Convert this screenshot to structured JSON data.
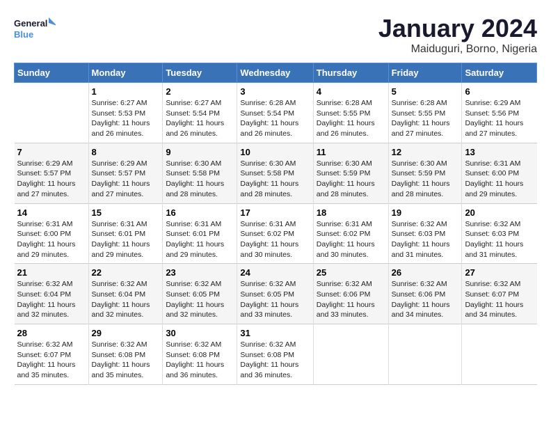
{
  "header": {
    "logo_line1": "General",
    "logo_line2": "Blue",
    "month": "January 2024",
    "location": "Maiduguri, Borno, Nigeria"
  },
  "days_of_week": [
    "Sunday",
    "Monday",
    "Tuesday",
    "Wednesday",
    "Thursday",
    "Friday",
    "Saturday"
  ],
  "weeks": [
    [
      {
        "num": "",
        "info": ""
      },
      {
        "num": "1",
        "info": "Sunrise: 6:27 AM\nSunset: 5:53 PM\nDaylight: 11 hours\nand 26 minutes."
      },
      {
        "num": "2",
        "info": "Sunrise: 6:27 AM\nSunset: 5:54 PM\nDaylight: 11 hours\nand 26 minutes."
      },
      {
        "num": "3",
        "info": "Sunrise: 6:28 AM\nSunset: 5:54 PM\nDaylight: 11 hours\nand 26 minutes."
      },
      {
        "num": "4",
        "info": "Sunrise: 6:28 AM\nSunset: 5:55 PM\nDaylight: 11 hours\nand 26 minutes."
      },
      {
        "num": "5",
        "info": "Sunrise: 6:28 AM\nSunset: 5:55 PM\nDaylight: 11 hours\nand 27 minutes."
      },
      {
        "num": "6",
        "info": "Sunrise: 6:29 AM\nSunset: 5:56 PM\nDaylight: 11 hours\nand 27 minutes."
      }
    ],
    [
      {
        "num": "7",
        "info": "Sunrise: 6:29 AM\nSunset: 5:57 PM\nDaylight: 11 hours\nand 27 minutes."
      },
      {
        "num": "8",
        "info": "Sunrise: 6:29 AM\nSunset: 5:57 PM\nDaylight: 11 hours\nand 27 minutes."
      },
      {
        "num": "9",
        "info": "Sunrise: 6:30 AM\nSunset: 5:58 PM\nDaylight: 11 hours\nand 28 minutes."
      },
      {
        "num": "10",
        "info": "Sunrise: 6:30 AM\nSunset: 5:58 PM\nDaylight: 11 hours\nand 28 minutes."
      },
      {
        "num": "11",
        "info": "Sunrise: 6:30 AM\nSunset: 5:59 PM\nDaylight: 11 hours\nand 28 minutes."
      },
      {
        "num": "12",
        "info": "Sunrise: 6:30 AM\nSunset: 5:59 PM\nDaylight: 11 hours\nand 28 minutes."
      },
      {
        "num": "13",
        "info": "Sunrise: 6:31 AM\nSunset: 6:00 PM\nDaylight: 11 hours\nand 29 minutes."
      }
    ],
    [
      {
        "num": "14",
        "info": "Sunrise: 6:31 AM\nSunset: 6:00 PM\nDaylight: 11 hours\nand 29 minutes."
      },
      {
        "num": "15",
        "info": "Sunrise: 6:31 AM\nSunset: 6:01 PM\nDaylight: 11 hours\nand 29 minutes."
      },
      {
        "num": "16",
        "info": "Sunrise: 6:31 AM\nSunset: 6:01 PM\nDaylight: 11 hours\nand 29 minutes."
      },
      {
        "num": "17",
        "info": "Sunrise: 6:31 AM\nSunset: 6:02 PM\nDaylight: 11 hours\nand 30 minutes."
      },
      {
        "num": "18",
        "info": "Sunrise: 6:31 AM\nSunset: 6:02 PM\nDaylight: 11 hours\nand 30 minutes."
      },
      {
        "num": "19",
        "info": "Sunrise: 6:32 AM\nSunset: 6:03 PM\nDaylight: 11 hours\nand 31 minutes."
      },
      {
        "num": "20",
        "info": "Sunrise: 6:32 AM\nSunset: 6:03 PM\nDaylight: 11 hours\nand 31 minutes."
      }
    ],
    [
      {
        "num": "21",
        "info": "Sunrise: 6:32 AM\nSunset: 6:04 PM\nDaylight: 11 hours\nand 32 minutes."
      },
      {
        "num": "22",
        "info": "Sunrise: 6:32 AM\nSunset: 6:04 PM\nDaylight: 11 hours\nand 32 minutes."
      },
      {
        "num": "23",
        "info": "Sunrise: 6:32 AM\nSunset: 6:05 PM\nDaylight: 11 hours\nand 32 minutes."
      },
      {
        "num": "24",
        "info": "Sunrise: 6:32 AM\nSunset: 6:05 PM\nDaylight: 11 hours\nand 33 minutes."
      },
      {
        "num": "25",
        "info": "Sunrise: 6:32 AM\nSunset: 6:06 PM\nDaylight: 11 hours\nand 33 minutes."
      },
      {
        "num": "26",
        "info": "Sunrise: 6:32 AM\nSunset: 6:06 PM\nDaylight: 11 hours\nand 34 minutes."
      },
      {
        "num": "27",
        "info": "Sunrise: 6:32 AM\nSunset: 6:07 PM\nDaylight: 11 hours\nand 34 minutes."
      }
    ],
    [
      {
        "num": "28",
        "info": "Sunrise: 6:32 AM\nSunset: 6:07 PM\nDaylight: 11 hours\nand 35 minutes."
      },
      {
        "num": "29",
        "info": "Sunrise: 6:32 AM\nSunset: 6:08 PM\nDaylight: 11 hours\nand 35 minutes."
      },
      {
        "num": "30",
        "info": "Sunrise: 6:32 AM\nSunset: 6:08 PM\nDaylight: 11 hours\nand 36 minutes."
      },
      {
        "num": "31",
        "info": "Sunrise: 6:32 AM\nSunset: 6:08 PM\nDaylight: 11 hours\nand 36 minutes."
      },
      {
        "num": "",
        "info": ""
      },
      {
        "num": "",
        "info": ""
      },
      {
        "num": "",
        "info": ""
      }
    ]
  ]
}
